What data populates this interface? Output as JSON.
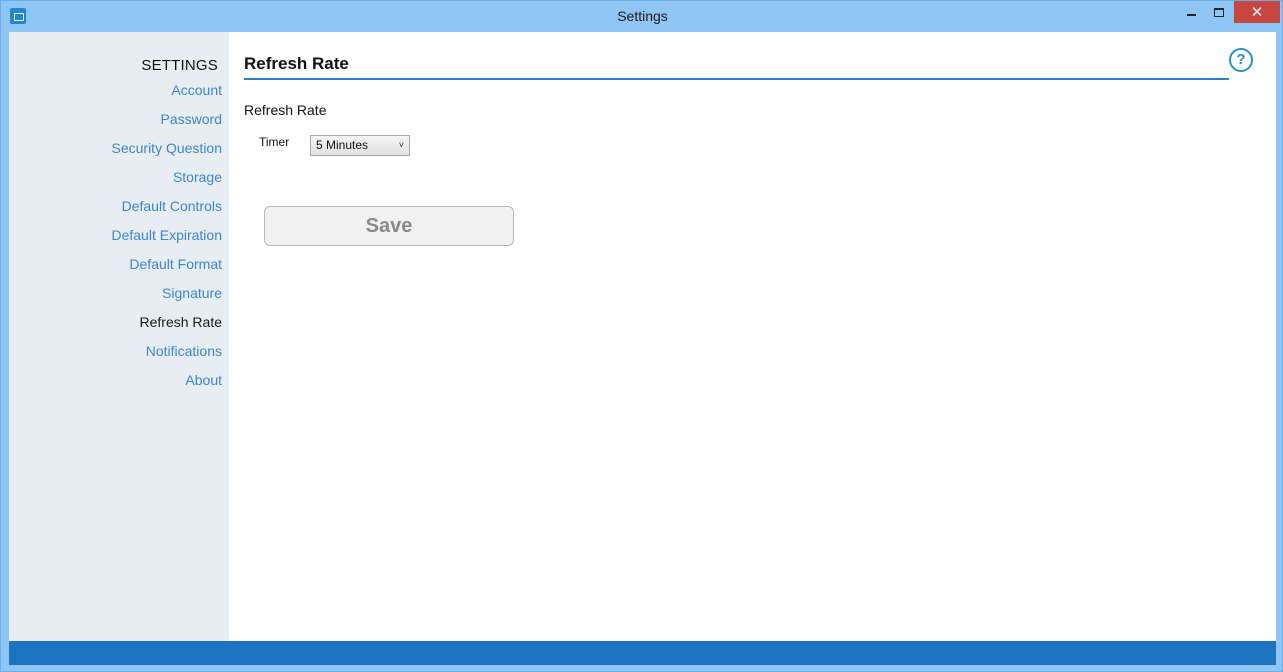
{
  "window": {
    "title": "Settings"
  },
  "titlebar_buttons": {
    "minimize": "minimize",
    "maximize": "maximize",
    "close": "✕"
  },
  "sidebar": {
    "heading": "SETTINGS",
    "items": [
      {
        "label": "Account"
      },
      {
        "label": "Password"
      },
      {
        "label": "Security Question"
      },
      {
        "label": "Storage"
      },
      {
        "label": "Default Controls"
      },
      {
        "label": "Default Expiration"
      },
      {
        "label": "Default Format"
      },
      {
        "label": "Signature"
      },
      {
        "label": "Refresh Rate",
        "active": true
      },
      {
        "label": "Notifications"
      },
      {
        "label": "About"
      }
    ]
  },
  "main": {
    "title": "Refresh Rate",
    "help_symbol": "?",
    "section_label": "Refresh Rate",
    "timer": {
      "label": "Timer",
      "selected": "5 Minutes",
      "arrow": "˅"
    },
    "save_label": "Save"
  },
  "colors": {
    "titlebar_bg": "#8ec5f5",
    "accent": "#2f7fcf",
    "link": "#3a86d4",
    "close_bg": "#c7463f",
    "statusbar_bg": "#1c74c0",
    "sidebar_bg": "#e8edf1"
  }
}
